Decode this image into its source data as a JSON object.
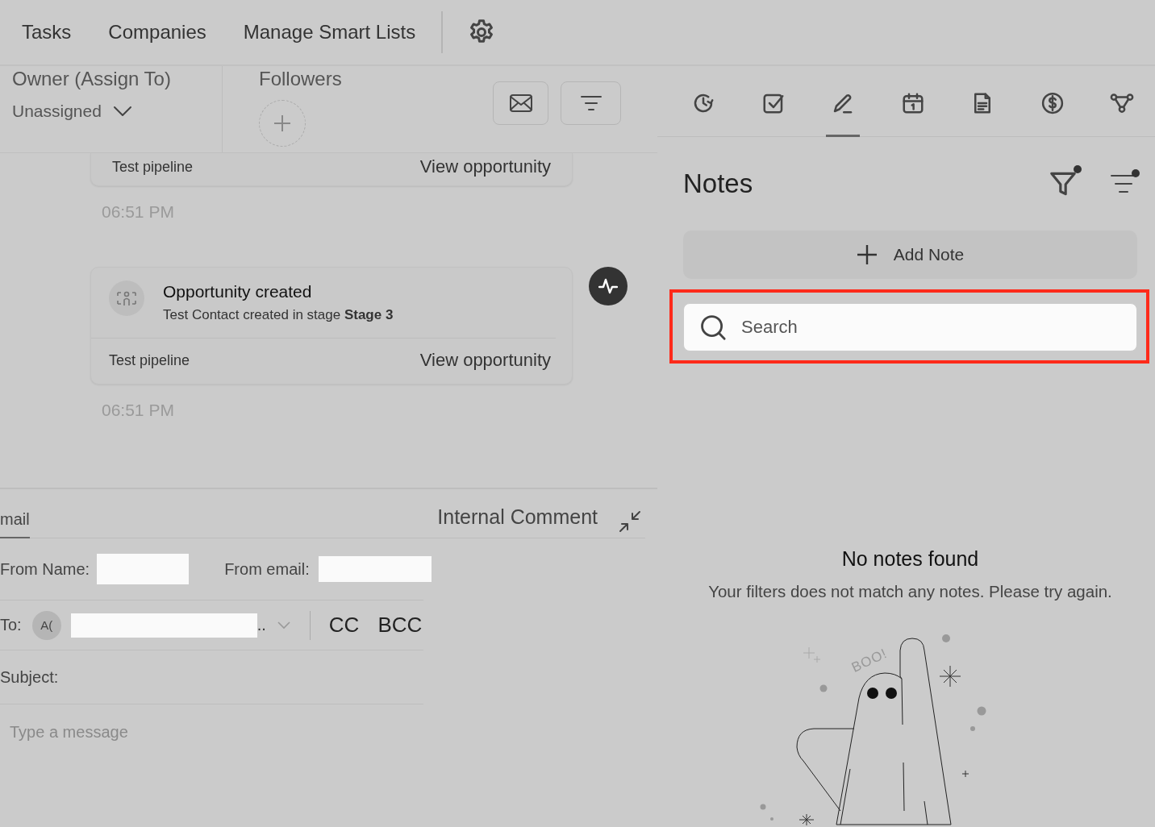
{
  "top_nav": {
    "tabs": [
      {
        "label": "Tasks"
      },
      {
        "label": "Companies"
      },
      {
        "label": "Manage Smart Lists"
      }
    ]
  },
  "owner": {
    "label": "Owner (Assign To)",
    "value": "Unassigned"
  },
  "followers": {
    "label": "Followers"
  },
  "timeline": [
    {
      "kind": "partial",
      "pipeline": "Test pipeline",
      "link": "View opportunity",
      "time": "06:51 PM"
    },
    {
      "kind": "card",
      "title": "Opportunity created",
      "description": "Test Contact created in stage **Stage 3**",
      "pipeline": "Test pipeline",
      "link": "View opportunity",
      "time": "06:51 PM"
    }
  ],
  "composer": {
    "tabs": [
      {
        "label": "mail",
        "selected": true
      },
      {
        "label": "Internal Comment",
        "selected": false
      }
    ],
    "from_name_label": "From Name:",
    "from_email_label": "From email:",
    "to_label": "To:",
    "to_avatar": "A(",
    "to_overflow": "..",
    "cc": "CC",
    "bcc": "BCC",
    "subject_label": "Subject:",
    "message_placeholder": "Type a message"
  },
  "side_tabs": [
    {
      "kind": "history",
      "selected": false
    },
    {
      "kind": "task",
      "selected": false
    },
    {
      "kind": "note",
      "selected": true
    },
    {
      "kind": "calendar",
      "selected": false
    },
    {
      "kind": "document",
      "selected": false
    },
    {
      "kind": "payment",
      "selected": false
    },
    {
      "kind": "workflow",
      "selected": false
    }
  ],
  "notes": {
    "title": "Notes",
    "filter_active": true,
    "sort_active": true,
    "add_button": "Add Note",
    "search": {
      "placeholder": "Search",
      "highlighted": true
    },
    "empty_title": "No notes found",
    "empty_message": "Your filters does not match any notes. Please try again.",
    "illustration_text": "BOO!"
  }
}
